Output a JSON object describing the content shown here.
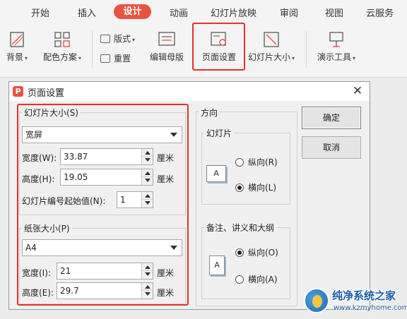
{
  "menu": {
    "tabs": [
      "开始",
      "插入",
      "设计",
      "动画",
      "幻灯片放映",
      "审阅",
      "视图",
      "云服务"
    ],
    "active": "设计"
  },
  "ribbon": {
    "background_label": "背景",
    "color_scheme_label": "配色方案",
    "layout_label": "版式",
    "reset_label": "重置",
    "edit_master_label": "编辑母版",
    "page_setup_label": "页面设置",
    "slide_size_label": "幻灯片大小",
    "presenter_tools_label": "演示工具"
  },
  "dialog": {
    "title": "页面设置",
    "close": "✕",
    "slide_size_group": "幻灯片大小(S)",
    "slide_size_value": "宽屏",
    "width_label": "宽度(W):",
    "width_value": "33.87",
    "height_label": "高度(H):",
    "height_value": "19.05",
    "unit": "厘米",
    "start_number_label": "幻灯片编号起始值(N):",
    "start_number_value": "1",
    "paper_size_group": "纸张大小(P)",
    "paper_size_value": "A4",
    "paper_width_label": "宽度(I):",
    "paper_width_value": "21",
    "paper_height_label": "高度(E):",
    "paper_height_value": "29.7",
    "orientation_group": "方向",
    "slides_group": "幻灯片",
    "portrait_r": "纵向(R)",
    "landscape_l": "横向(L)",
    "notes_group": "备注、讲义和大纲",
    "portrait_o": "纵向(O)",
    "landscape_a": "横向(A)",
    "ok": "确定",
    "cancel": "取消",
    "icon_letter": "A",
    "title_icon_letter": "P"
  },
  "watermark": {
    "title": "纯净系统之家",
    "url": "www.kzmyhome.com"
  },
  "colors": {
    "accent": "#e8533f",
    "highlight": "#e6312a"
  }
}
